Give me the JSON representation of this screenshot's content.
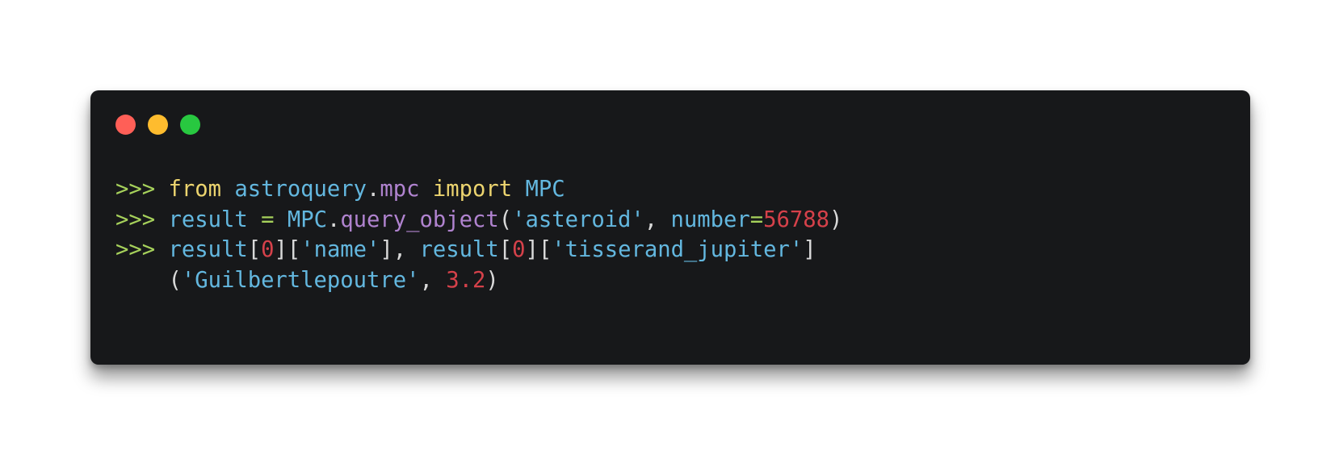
{
  "colors": {
    "window_bg": "#17181a",
    "traffic_red": "#ff5f57",
    "traffic_yellow": "#febc2e",
    "traffic_green": "#28c840",
    "prompt": "#a6d15b",
    "keyword": "#ecd46f",
    "identifier": "#63b7df",
    "attribute": "#b083cf",
    "number": "#d5414a",
    "punctuation": "#d9d9d9"
  },
  "window": {
    "buttons": [
      {
        "name": "close",
        "color_key": "traffic_red"
      },
      {
        "name": "minimize",
        "color_key": "traffic_yellow"
      },
      {
        "name": "maximize",
        "color_key": "traffic_green"
      }
    ]
  },
  "code": {
    "lines": [
      [
        {
          "text": ">>> ",
          "kind": "prompt"
        },
        {
          "text": "from",
          "kind": "keyword"
        },
        {
          "text": " ",
          "kind": "punctuation"
        },
        {
          "text": "astroquery",
          "kind": "identifier"
        },
        {
          "text": ".",
          "kind": "punctuation"
        },
        {
          "text": "mpc",
          "kind": "attribute"
        },
        {
          "text": " ",
          "kind": "punctuation"
        },
        {
          "text": "import",
          "kind": "keyword"
        },
        {
          "text": " ",
          "kind": "punctuation"
        },
        {
          "text": "MPC",
          "kind": "identifier"
        }
      ],
      [
        {
          "text": ">>> ",
          "kind": "prompt"
        },
        {
          "text": "result",
          "kind": "identifier"
        },
        {
          "text": " ",
          "kind": "punctuation"
        },
        {
          "text": "=",
          "kind": "prompt"
        },
        {
          "text": " ",
          "kind": "punctuation"
        },
        {
          "text": "MPC",
          "kind": "identifier"
        },
        {
          "text": ".",
          "kind": "punctuation"
        },
        {
          "text": "query_object",
          "kind": "attribute"
        },
        {
          "text": "(",
          "kind": "punctuation"
        },
        {
          "text": "'asteroid'",
          "kind": "identifier"
        },
        {
          "text": ", ",
          "kind": "punctuation"
        },
        {
          "text": "number",
          "kind": "identifier"
        },
        {
          "text": "=",
          "kind": "prompt"
        },
        {
          "text": "56788",
          "kind": "number"
        },
        {
          "text": ")",
          "kind": "punctuation"
        }
      ],
      [
        {
          "text": ">>> ",
          "kind": "prompt"
        },
        {
          "text": "result",
          "kind": "identifier"
        },
        {
          "text": "[",
          "kind": "punctuation"
        },
        {
          "text": "0",
          "kind": "number"
        },
        {
          "text": "][",
          "kind": "punctuation"
        },
        {
          "text": "'name'",
          "kind": "identifier"
        },
        {
          "text": "], ",
          "kind": "punctuation"
        },
        {
          "text": "result",
          "kind": "identifier"
        },
        {
          "text": "[",
          "kind": "punctuation"
        },
        {
          "text": "0",
          "kind": "number"
        },
        {
          "text": "][",
          "kind": "punctuation"
        },
        {
          "text": "'tisserand_jupiter'",
          "kind": "identifier"
        },
        {
          "text": "]",
          "kind": "punctuation"
        }
      ],
      [
        {
          "text": "    ",
          "kind": "punctuation"
        },
        {
          "text": "(",
          "kind": "punctuation"
        },
        {
          "text": "'Guilbertlepoutre'",
          "kind": "identifier"
        },
        {
          "text": ", ",
          "kind": "punctuation"
        },
        {
          "text": "3.2",
          "kind": "number"
        },
        {
          "text": ")",
          "kind": "punctuation"
        }
      ]
    ]
  }
}
